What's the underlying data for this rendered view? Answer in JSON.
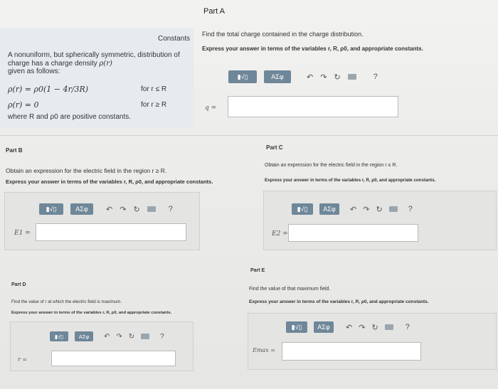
{
  "part_a": {
    "title": "Part A",
    "constants_label": "Constants",
    "intro": "A nonuniform, but spherically symmetric, distribution of charge has a charge density",
    "density_symbol": "ρ(r)",
    "given": "given as follows:",
    "eq1": "ρ(r) = ρ0(1 − 4r/3R)",
    "eq1_cond": "for r ≤ R",
    "eq2": "ρ(r) = 0",
    "eq2_cond": "for r ≥ R",
    "where": "where R and ρ0 are positive constants.",
    "question": "Find the total charge contained in the charge distribution.",
    "instruction": "Express your answer in terms of the variables r, R, ρ0, and appropriate constants.",
    "answer_label": "q =",
    "answer_value": ""
  },
  "part_b": {
    "title": "Part B",
    "question": "Obtain an expression for the electric field in the region r ≥ R.",
    "instruction": "Express your answer in terms of the variables r, R, ρ0, and appropriate constants.",
    "answer_label": "E1 =",
    "answer_value": ""
  },
  "part_c": {
    "title": "Part C",
    "question": "Obtain an expression for the electric field in the region r ≤ R.",
    "instruction": "Express your answer in terms of the variables r, R, ρ0, and appropriate constants.",
    "answer_label": "E2 =",
    "answer_value": ""
  },
  "part_d": {
    "title": "Part D",
    "question": "Find the value of r at which the electric field is maximum.",
    "instruction": "Express your answer in terms of the variables r, R, ρ0, and appropriate constants.",
    "answer_label": "r =",
    "answer_value": ""
  },
  "part_e": {
    "title": "Part E",
    "question": "Find the value of that maximum field.",
    "instruction": "Express your answer in terms of the variables r, R, ρ0, and appropriate constants.",
    "answer_label": "Emax =",
    "answer_value": ""
  },
  "toolbar": {
    "templates_label": "▮√▯",
    "symbols_label": "ΑΣφ",
    "undo_glyph": "↶",
    "redo_glyph": "↷",
    "reset_glyph": "↻",
    "help_glyph": "?"
  }
}
